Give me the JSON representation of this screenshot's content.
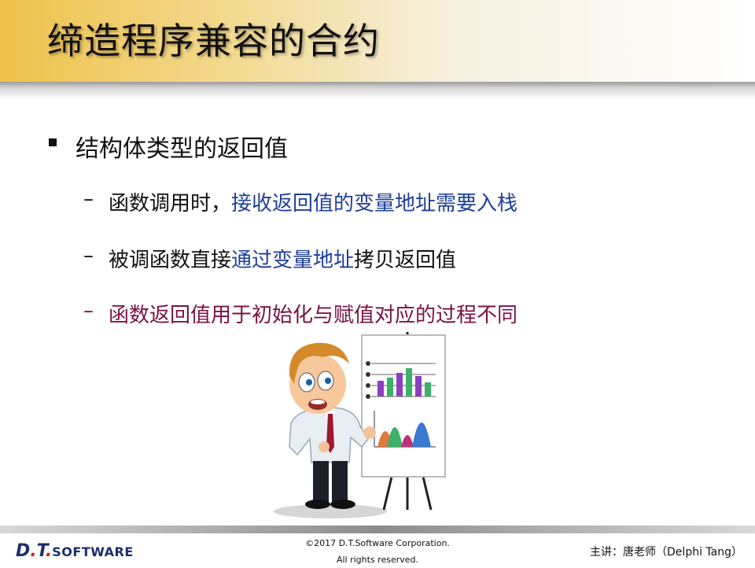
{
  "slide": {
    "title": "缔造程序兼容的合约",
    "bullet": "结构体类型的返回值",
    "sub_items": [
      {
        "dash": "–",
        "parts": [
          "函数调用时，",
          "接收返回值的变量地址需要入栈"
        ]
      },
      {
        "dash": "–",
        "parts": [
          "被调函数直接",
          "通过变量地址",
          "拷贝返回值"
        ]
      },
      {
        "dash": "–",
        "parts": [
          "函数返回值用于初始化与赋值对应的过程不同"
        ]
      }
    ]
  },
  "footer": {
    "logo_d": "D",
    "logo_dot1": ".",
    "logo_t": "T",
    "logo_dot2": ".",
    "logo_software": "SOFTWARE",
    "copyright_line1": "©2017 D.T.Software Corporation.",
    "copyright_line2": "All rights reserved.",
    "speaker": "主讲：唐老师（Delphi Tang）"
  },
  "colors": {
    "title_gold": "#eec24a",
    "highlight_blue": "#1f3f9a",
    "highlight_maroon": "#7a1243"
  }
}
